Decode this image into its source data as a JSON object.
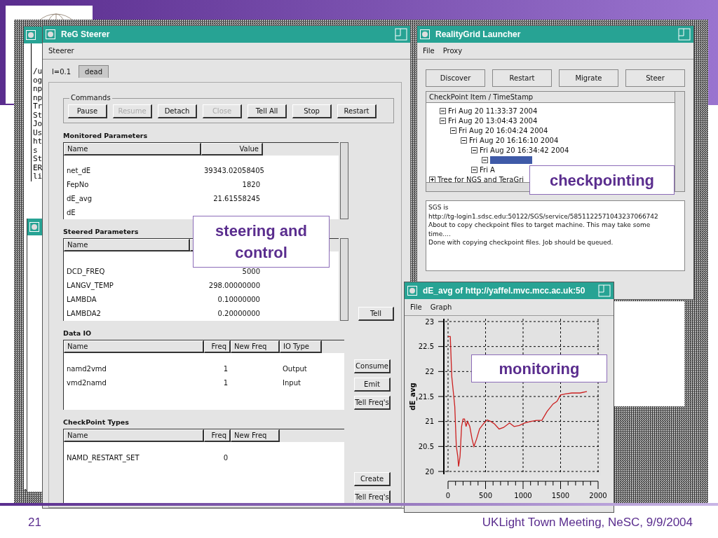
{
  "slide": {
    "number": "21",
    "footer": "UKLight Town Meeting, NeSC, 9/9/2004"
  },
  "terminal": {
    "lines": [
      "/u",
      "og",
      "np",
      "np",
      "Tr",
      "St",
      "Jo",
      "Us",
      "ht",
      "s",
      "St",
      "ER",
      "li"
    ]
  },
  "steerer": {
    "title": "ReG Steerer",
    "menu": [
      "Steerer"
    ],
    "tabs": [
      {
        "label": "l=0.1",
        "selected": true
      },
      {
        "label": "dead",
        "selected": false
      }
    ],
    "commands": {
      "title": "Commands",
      "buttons": [
        {
          "label": "Pause",
          "disabled": false
        },
        {
          "label": "Resume",
          "disabled": true
        },
        {
          "label": "Detach",
          "disabled": false
        },
        {
          "label": "Close",
          "disabled": true
        },
        {
          "label": "Tell All",
          "disabled": false
        },
        {
          "label": "Stop",
          "disabled": false
        },
        {
          "label": "Restart",
          "disabled": false
        }
      ]
    },
    "sections": [
      {
        "title": "Monitored Parameters",
        "scrollbar": true,
        "columns": [
          {
            "label": "Name"
          },
          {
            "label": "Value",
            "numeric": true
          }
        ],
        "rows": [
          [
            "net_dE",
            "39343.02058405"
          ],
          [
            "FepNo",
            "1820"
          ],
          [
            "dE_avg",
            "21.61558245"
          ],
          [
            "dE"
          ]
        ]
      },
      {
        "title": "Steered Parameters",
        "scrollbar": true,
        "columns": [
          {
            "label": "Name"
          },
          {
            "numeric": true
          }
        ],
        "rows": [
          [
            "DCD_FREQ",
            "5000"
          ],
          [
            "LANGV_TEMP",
            "298.00000000"
          ],
          [
            "LAMBDA",
            "0.10000000"
          ],
          [
            "LAMBDA2",
            "0.20000000"
          ]
        ],
        "buttons": [
          "Tell"
        ]
      },
      {
        "title": "Data IO",
        "scrollbar": false,
        "columns": [
          {
            "label": "Name"
          },
          {
            "label": "Freq",
            "numeric": true
          },
          {
            "label": "New Freq"
          },
          {
            "label": "IO Type"
          }
        ],
        "rows": [
          [
            "namd2vmd",
            "1",
            "",
            "Output"
          ],
          [
            "vmd2namd",
            "1",
            "",
            "Input"
          ]
        ],
        "buttons": [
          "Consume",
          "Emit",
          "Tell Freq's"
        ]
      },
      {
        "title": "CheckPoint Types",
        "scrollbar": false,
        "columns": [
          {
            "label": "Name"
          },
          {
            "label": "Freq",
            "numeric": true
          },
          {
            "label": "New Freq"
          }
        ],
        "rows": [
          [
            "NAMD_RESTART_SET",
            "0"
          ]
        ],
        "buttons": [
          "Create",
          "Tell Freq's"
        ]
      }
    ]
  },
  "launcher": {
    "title": "RealityGrid Launcher",
    "menu": [
      "File",
      "Proxy"
    ],
    "buttons": [
      "Discover",
      "Restart",
      "Migrate",
      "Steer"
    ],
    "tree": {
      "header": "CheckPoint Item / TimeStamp",
      "nodes": [
        {
          "children": [
            {
              "label": "Fri Aug 20 11:33:37 2004",
              "expanded": true
            },
            {
              "label": "Fri Aug 20 13:04:43 2004",
              "expanded": true,
              "children": [
                {
                  "label": "Fri Aug 20 16:04:24 2004",
                  "expanded": true,
                  "children": [
                    {
                      "label": "Fri Aug 20 16:16:10 2004",
                      "expanded": true,
                      "children": [
                        {
                          "label": "Fri Aug 20 16:34:42 2004",
                          "expanded": true,
                          "children": [
                            {
                              "expanded": true,
                              "selected": true
                            }
                          ]
                        },
                        {
                          "label": "Fri A",
                          "expanded": true
                        }
                      ]
                    }
                  ]
                }
              ]
            }
          ]
        },
        {
          "label": "Tree for NGS and TeraGri",
          "expanded": false
        }
      ]
    },
    "log": [
      "SGS is",
      "http://tg-login1.sdsc.edu:50122/SGS/service/5851122571043237066742",
      "About to copy checkpoint files to target machine. This may take some",
      "time....",
      "Done with copying checkpoint files.  Job should be queued."
    ]
  },
  "graph": {
    "title": "dE_avg of http://yaffel.mvc.mcc.ac.uk:50",
    "menu": [
      "File",
      "Graph"
    ],
    "chart_data": {
      "type": "line",
      "ylabel": "dE_avg",
      "grid": true,
      "xlim": [
        0,
        2000
      ],
      "ylim": [
        20,
        23
      ],
      "xticks": [
        0,
        500,
        1000,
        1500,
        2000
      ],
      "yticks": [
        20,
        20.5,
        21,
        21.5,
        22,
        22.5,
        23
      ],
      "x": [
        0,
        30,
        50,
        90,
        110,
        130,
        140,
        160,
        180,
        200,
        220,
        240,
        260,
        290,
        320,
        345,
        380,
        420,
        470,
        520,
        570,
        620,
        680,
        740,
        820,
        880,
        950,
        1020,
        1100,
        1180,
        1250,
        1320,
        1400,
        1450,
        1500,
        1560,
        1650,
        1760,
        1850
      ],
      "series": [
        {
          "color": "#cc2020",
          "values": [
            22.7,
            22.7,
            21.9,
            21.3,
            20.5,
            20.3,
            20.1,
            20.3,
            20.9,
            21.05,
            21.05,
            20.9,
            21.0,
            20.9,
            20.65,
            20.5,
            20.65,
            20.85,
            20.95,
            21.03,
            21.0,
            20.95,
            20.85,
            20.88,
            20.97,
            20.9,
            20.92,
            20.97,
            21.0,
            21.02,
            21.02,
            21.2,
            21.35,
            21.4,
            21.53,
            21.55,
            21.57,
            21.57,
            21.6
          ]
        }
      ]
    }
  },
  "callouts": [
    {
      "text": "steering and control"
    },
    {
      "text": "checkpointing"
    },
    {
      "text": "monitoring"
    }
  ]
}
